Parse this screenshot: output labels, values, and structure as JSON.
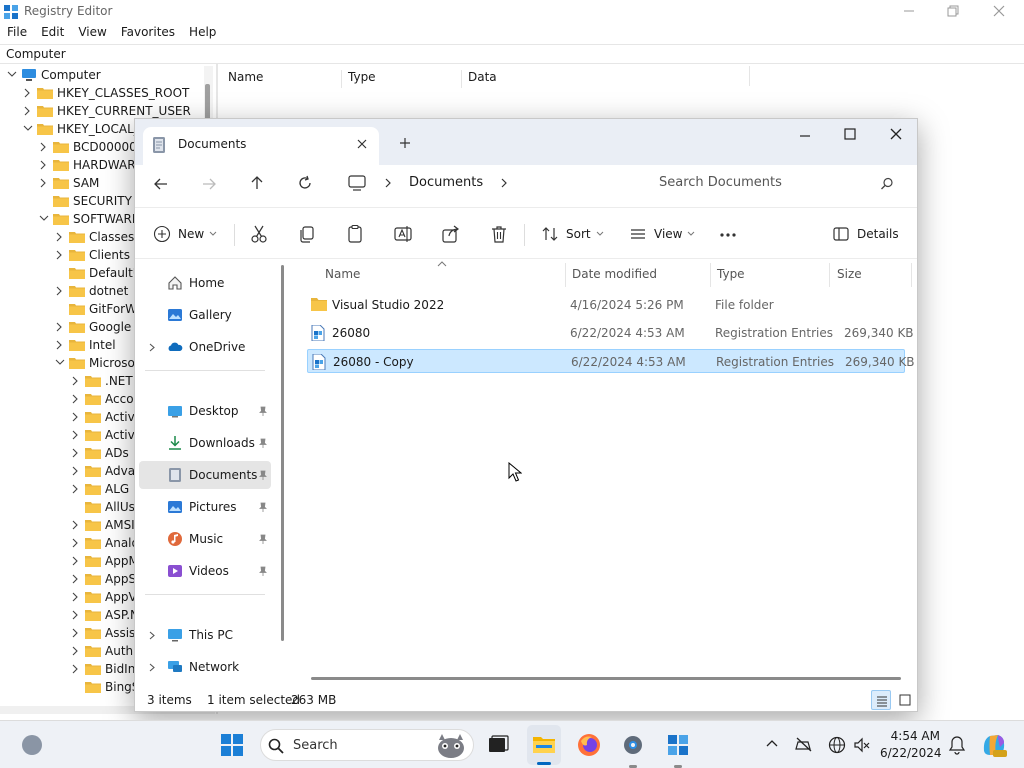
{
  "registry": {
    "title": "Registry Editor",
    "menu": [
      "File",
      "Edit",
      "View",
      "Favorites",
      "Help"
    ],
    "address": "Computer",
    "tree": [
      {
        "label": "Computer",
        "indent": 0,
        "expanded": true,
        "computer": true
      },
      {
        "label": "HKEY_CLASSES_ROOT",
        "indent": 1,
        "expanded": false
      },
      {
        "label": "HKEY_CURRENT_USER",
        "indent": 1,
        "expanded": false
      },
      {
        "label": "HKEY_LOCAL_",
        "indent": 1,
        "expanded": true
      },
      {
        "label": "BCD000000",
        "indent": 2,
        "expanded": false
      },
      {
        "label": "HARDWARE",
        "indent": 2,
        "expanded": false
      },
      {
        "label": "SAM",
        "indent": 2,
        "expanded": false
      },
      {
        "label": "SECURITY",
        "indent": 2,
        "expanded": null
      },
      {
        "label": "SOFTWARE",
        "indent": 2,
        "expanded": true
      },
      {
        "label": "Classes",
        "indent": 3,
        "expanded": false
      },
      {
        "label": "Clients",
        "indent": 3,
        "expanded": false
      },
      {
        "label": "DefaultU",
        "indent": 3,
        "expanded": null
      },
      {
        "label": "dotnet",
        "indent": 3,
        "expanded": false
      },
      {
        "label": "GitForW",
        "indent": 3,
        "expanded": null
      },
      {
        "label": "Google",
        "indent": 3,
        "expanded": false
      },
      {
        "label": "Intel",
        "indent": 3,
        "expanded": false
      },
      {
        "label": "Microso",
        "indent": 3,
        "expanded": true
      },
      {
        "label": ".NET",
        "indent": 4,
        "expanded": false
      },
      {
        "label": "Acco",
        "indent": 4,
        "expanded": false
      },
      {
        "label": "Activ",
        "indent": 4,
        "expanded": false
      },
      {
        "label": "Activ",
        "indent": 4,
        "expanded": false
      },
      {
        "label": "ADs",
        "indent": 4,
        "expanded": false
      },
      {
        "label": "Adva",
        "indent": 4,
        "expanded": false
      },
      {
        "label": "ALG",
        "indent": 4,
        "expanded": false
      },
      {
        "label": "AllUs",
        "indent": 4,
        "expanded": null
      },
      {
        "label": "AMSI",
        "indent": 4,
        "expanded": false
      },
      {
        "label": "Analo",
        "indent": 4,
        "expanded": false
      },
      {
        "label": "AppM",
        "indent": 4,
        "expanded": false
      },
      {
        "label": "AppS",
        "indent": 4,
        "expanded": false
      },
      {
        "label": "AppV",
        "indent": 4,
        "expanded": false
      },
      {
        "label": "ASP.N",
        "indent": 4,
        "expanded": false
      },
      {
        "label": "Assis",
        "indent": 4,
        "expanded": false
      },
      {
        "label": "Auth",
        "indent": 4,
        "expanded": false
      },
      {
        "label": "BidIn",
        "indent": 4,
        "expanded": false
      },
      {
        "label": "BingS",
        "indent": 4,
        "expanded": null
      }
    ],
    "columns": [
      "Name",
      "Type",
      "Data"
    ]
  },
  "explorer": {
    "tab_title": "Documents",
    "breadcrumb": "Documents",
    "search_placeholder": "Search Documents",
    "toolbar": {
      "new": "New",
      "sort": "Sort",
      "view": "View",
      "details": "Details"
    },
    "nav": {
      "home": "Home",
      "gallery": "Gallery",
      "onedrive": "OneDrive",
      "desktop": "Desktop",
      "downloads": "Downloads",
      "documents": "Documents",
      "pictures": "Pictures",
      "music": "Music",
      "videos": "Videos",
      "thispc": "This PC",
      "network": "Network"
    },
    "columns": {
      "name": "Name",
      "date": "Date modified",
      "type": "Type",
      "size": "Size"
    },
    "files": [
      {
        "name": "Visual Studio 2022",
        "date": "4/16/2024 5:26 PM",
        "type": "File folder",
        "size": "",
        "kind": "folder",
        "selected": false
      },
      {
        "name": "26080",
        "date": "6/22/2024 4:53 AM",
        "type": "Registration Entries",
        "size": "269,340 KB",
        "kind": "reg",
        "selected": false
      },
      {
        "name": "26080 - Copy",
        "date": "6/22/2024 4:53 AM",
        "type": "Registration Entries",
        "size": "269,340 KB",
        "kind": "reg",
        "selected": true
      }
    ],
    "status": {
      "count": "3 items",
      "selection": "1 item selected",
      "size": "263 MB"
    }
  },
  "taskbar": {
    "search_label": "Search",
    "time": "4:54 AM",
    "date": "6/22/2024"
  },
  "colors": {
    "accent": "#0067c0",
    "folder": "#f7c548",
    "selection": "#cce8ff",
    "selection_border": "#99d1ff"
  }
}
